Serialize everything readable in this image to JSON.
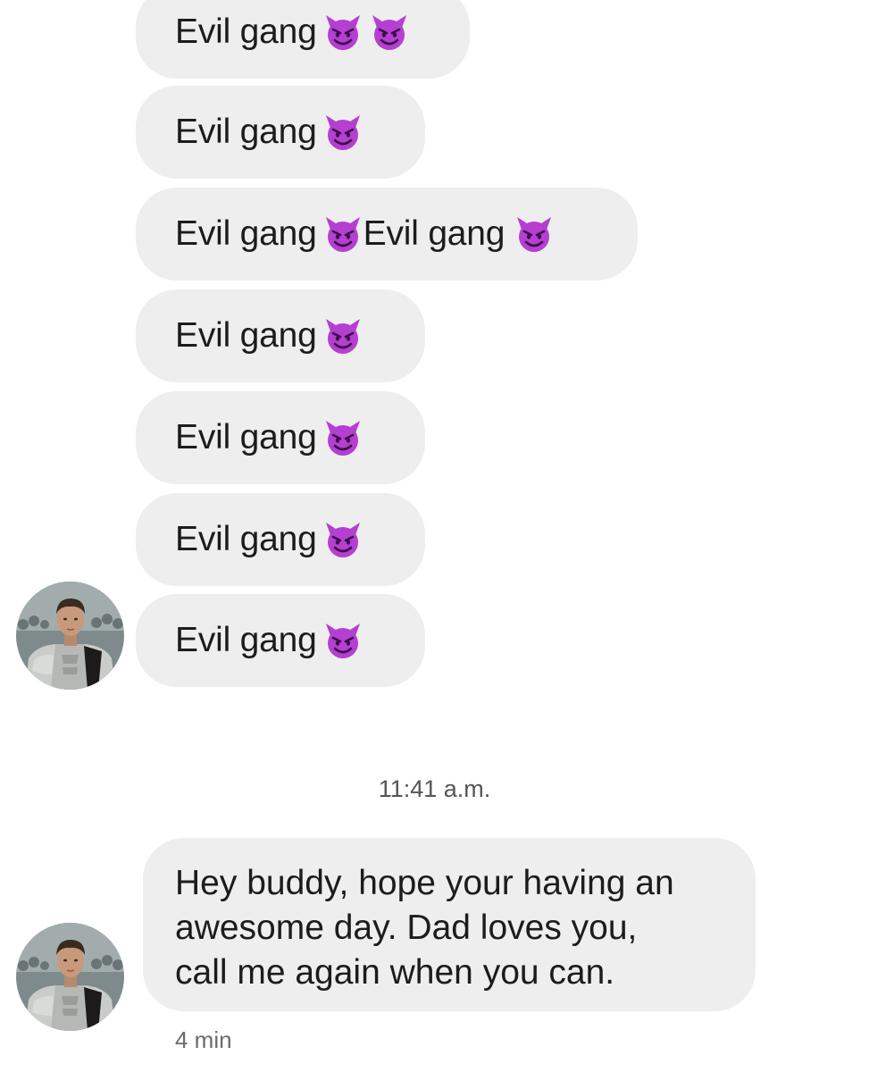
{
  "conversation": {
    "messages": [
      {
        "parts": [
          "Evil gang"
        ],
        "emoji_count": 2
      },
      {
        "parts": [
          "Evil gang"
        ],
        "emoji_count": 1
      },
      {
        "parts": [
          "Evil gang",
          "Evil gang"
        ],
        "emoji_count": 1
      },
      {
        "parts": [
          "Evil gang"
        ],
        "emoji_count": 1
      },
      {
        "parts": [
          "Evil gang"
        ],
        "emoji_count": 1
      },
      {
        "parts": [
          "Evil gang"
        ],
        "emoji_count": 1
      },
      {
        "parts": [
          "Evil gang"
        ],
        "emoji_count": 1
      }
    ],
    "emoji": "smiling-imp-emoji",
    "timestamp": "11:41 a.m.",
    "last_message": {
      "lines": [
        "Hey buddy, hope your having an",
        "awesome day. Dad loves you,",
        "call me again when you can."
      ],
      "age": "4 min"
    }
  },
  "colors": {
    "bubble_bg": "#eeeeee",
    "emoji_purple": "#b43fd0",
    "text": "#1c1c1c",
    "meta_text": "#6b6b6b"
  }
}
